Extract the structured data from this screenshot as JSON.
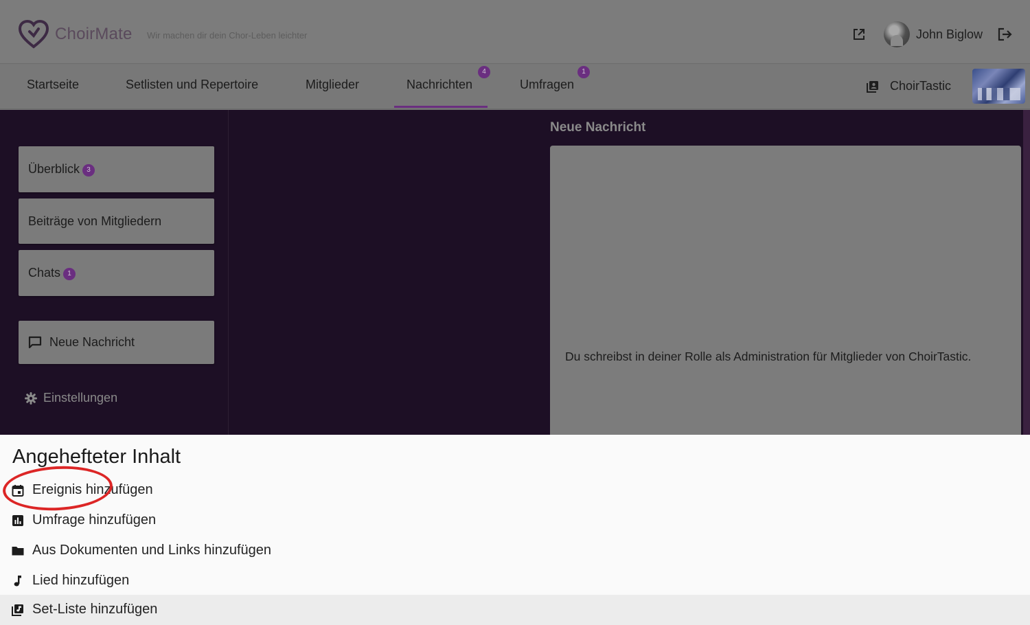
{
  "header": {
    "brand": "ChoirMate",
    "tagline": "Wir machen dir dein Chor-Leben leichter",
    "user_name": "John Biglow",
    "icons": [
      "heart-logo-icon",
      "external-link-icon",
      "avatar",
      "logout-icon"
    ]
  },
  "nav": {
    "tabs": [
      {
        "label": "Startseite"
      },
      {
        "label": "Setlisten und Repertoire"
      },
      {
        "label": "Mitglieder"
      },
      {
        "label": "Nachrichten",
        "badge": "4",
        "active": true
      },
      {
        "label": "Umfragen",
        "badge": "1"
      }
    ],
    "choir_name": "ChoirTastic"
  },
  "sidebar": {
    "items": [
      {
        "label": "Überblick",
        "badge": "3"
      },
      {
        "label": "Beiträge von Mitgliedern"
      },
      {
        "label": "Chats",
        "badge": "1"
      }
    ],
    "new_message": "Neue Nachricht",
    "settings": "Einstellungen"
  },
  "compose": {
    "title": "Neue Nachricht",
    "note": "Du schreibst in deiner Rolle als Administration für Mitglieder von ChoirTastic."
  },
  "sheet": {
    "title": "Angehefteter Inhalt",
    "items": [
      {
        "label": "Ereignis hinzufügen",
        "icon": "calendar-icon"
      },
      {
        "label": "Umfrage hinzufügen",
        "icon": "poll-icon"
      },
      {
        "label": "Aus Dokumenten und Links hinzufügen",
        "icon": "folder-icon"
      },
      {
        "label": "Lied hinzufügen",
        "icon": "music-note-icon"
      },
      {
        "label": "Set-Liste hinzufügen",
        "icon": "setlist-icon",
        "highlighted": true
      }
    ]
  },
  "colors": {
    "accent": "#6a2e80",
    "dim_overlay": "#1d0f25",
    "annotation_circle": "#dc2626"
  }
}
